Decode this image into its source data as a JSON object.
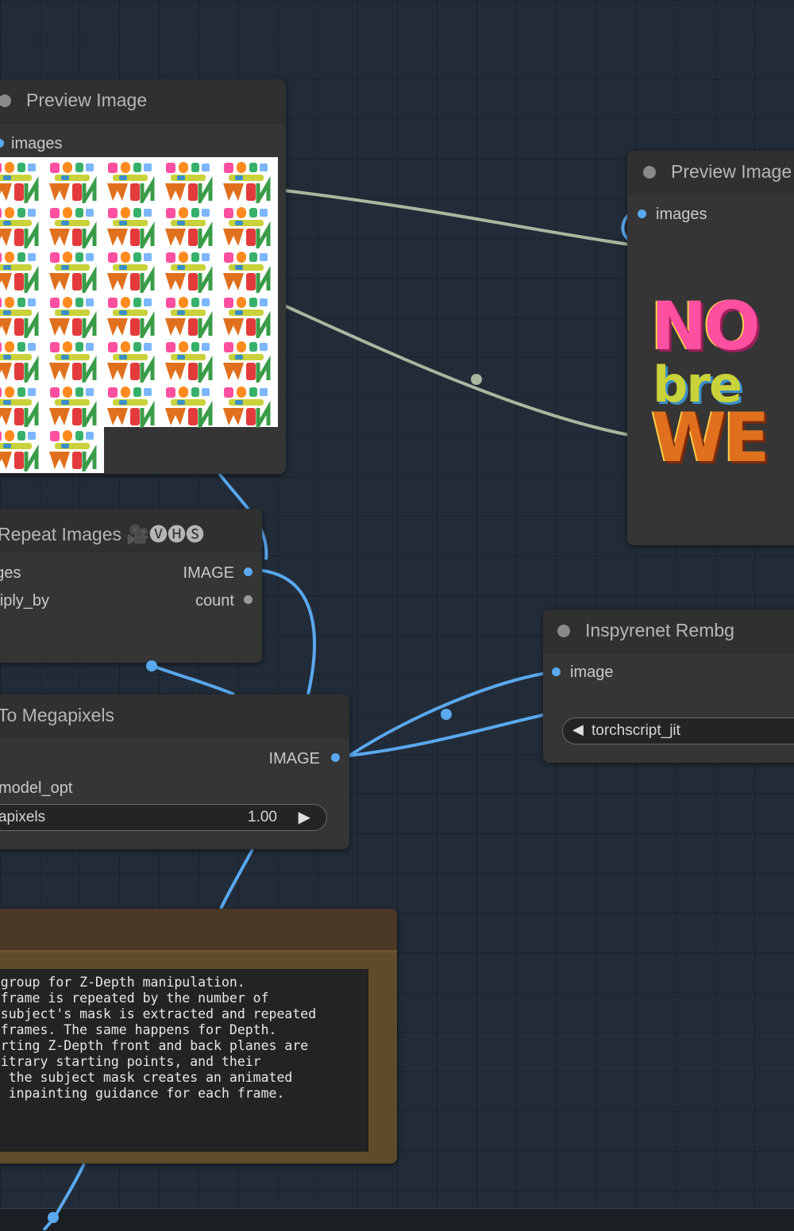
{
  "nodes": {
    "preview_left": {
      "title": "Preview Image",
      "input_label": "images"
    },
    "preview_right": {
      "title": "Preview Image",
      "input_label": "images"
    },
    "repeat_images": {
      "title": "Repeat Images 🎥🅥🅗🅢",
      "inputs": [
        "images",
        "multiply_by"
      ],
      "outputs": [
        "IMAGE",
        "count"
      ]
    },
    "to_megapixels": {
      "title": "To Megapixels",
      "output_label": "IMAGE",
      "input_model_opt": "model_opt",
      "widget_label": "megapixels",
      "widget_value": "1.00"
    },
    "inspyrenet": {
      "title": "Inspyrenet Rembg",
      "input_label": "image",
      "widget_value": "torchscript_jit"
    }
  },
  "note": {
    "lines": [
      "in group for Z-Depth manipulation.",
      "le frame is repeated by the number of",
      "he subject's mask is extracted and repeated",
      "of frames. The same happens for Depth.",
      "starting Z-Depth front and back planes are",
      "arbitrary starting points, and their",
      "ith the subject mask creates an animated",
      " as inpainting guidance for each frame."
    ]
  },
  "preview_image_text": [
    "NO",
    "bre",
    "WE"
  ],
  "colors": {
    "canvas": "#222c38",
    "node": "#353535",
    "image_link": "#5aa8ef",
    "gray_link": "#a9b79f",
    "note": "#5e4b2a"
  }
}
